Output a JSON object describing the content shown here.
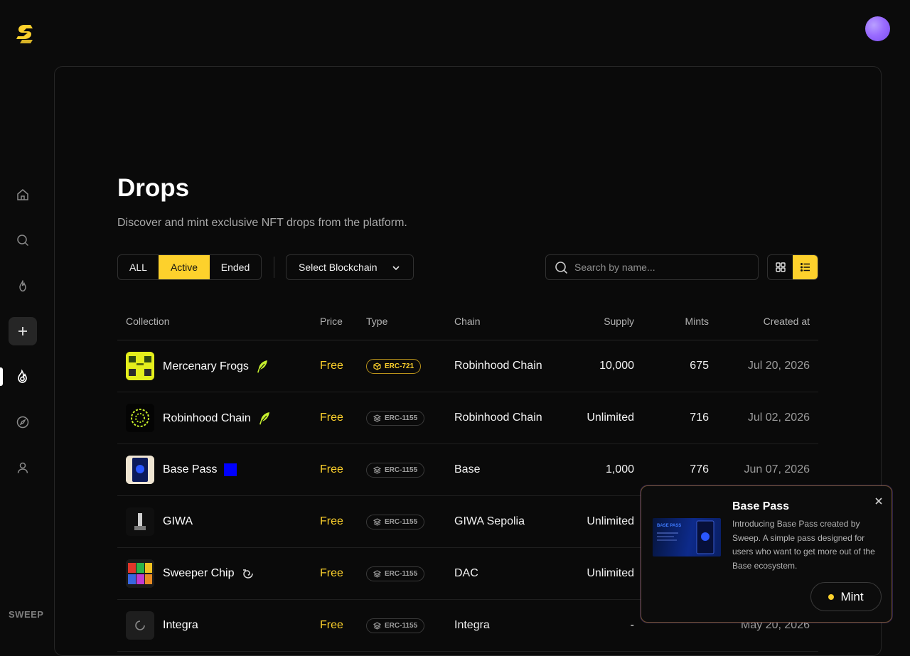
{
  "sidebar": {
    "logo": "sweep-logo",
    "items": [
      {
        "icon": "home-icon"
      },
      {
        "icon": "search-icon"
      },
      {
        "icon": "flame-icon"
      },
      {
        "icon": "plus-icon"
      },
      {
        "icon": "drops-icon"
      },
      {
        "icon": "compass-icon"
      },
      {
        "icon": "user-icon"
      }
    ],
    "brand": "SWEEP"
  },
  "page": {
    "title": "Drops",
    "subtitle": "Discover and mint exclusive NFT drops from the platform."
  },
  "filters": {
    "tabs": [
      "ALL",
      "Active",
      "Ended"
    ],
    "active_tab": "Active",
    "chain_select": "Select Blockchain",
    "search_placeholder": "Search by name...",
    "view_mode": "list"
  },
  "table": {
    "columns": [
      "Collection",
      "Price",
      "Type",
      "Chain",
      "Supply",
      "Mints",
      "Created at"
    ],
    "rows": [
      {
        "name": "Mercenary Frogs",
        "chain_icon": "feather-icon",
        "price": "Free",
        "type": "ERC-721",
        "chain": "Robinhood Chain",
        "supply": "10,000",
        "mints": "675",
        "created": "Jul 20, 2026"
      },
      {
        "name": "Robinhood Chain",
        "chain_icon": "feather-icon",
        "price": "Free",
        "type": "ERC-1155",
        "chain": "Robinhood Chain",
        "supply": "Unlimited",
        "mints": "716",
        "created": "Jul 02, 2026"
      },
      {
        "name": "Base Pass",
        "chain_icon": "base-square-icon",
        "price": "Free",
        "type": "ERC-1155",
        "chain": "Base",
        "supply": "1,000",
        "mints": "776",
        "created": "Jun 07, 2026"
      },
      {
        "name": "GIWA",
        "chain_icon": "",
        "price": "Free",
        "type": "ERC-1155",
        "chain": "GIWA Sepolia",
        "supply": "Unlimited",
        "mints": "",
        "created": ""
      },
      {
        "name": "Sweeper Chip",
        "chain_icon": "swirl-icon",
        "price": "Free",
        "type": "ERC-1155",
        "chain": "DAC",
        "supply": "Unlimited",
        "mints": "",
        "created": ""
      },
      {
        "name": "Integra",
        "chain_icon": "",
        "price": "Free",
        "type": "ERC-1155",
        "chain": "Integra",
        "supply": "-",
        "mints": "",
        "created": "May 20, 2026"
      }
    ]
  },
  "popup": {
    "title": "Base Pass",
    "description": "Introducing Base Pass created by Sweep. A simple pass designed for users who want to get more out of the Base ecosystem.",
    "cta": "Mint",
    "image_text": "BASE PASS"
  },
  "colors": {
    "accent": "#fdd12c",
    "background": "#0b0b0b",
    "panel_border": "#262626",
    "avatar": "#9a6cff"
  }
}
